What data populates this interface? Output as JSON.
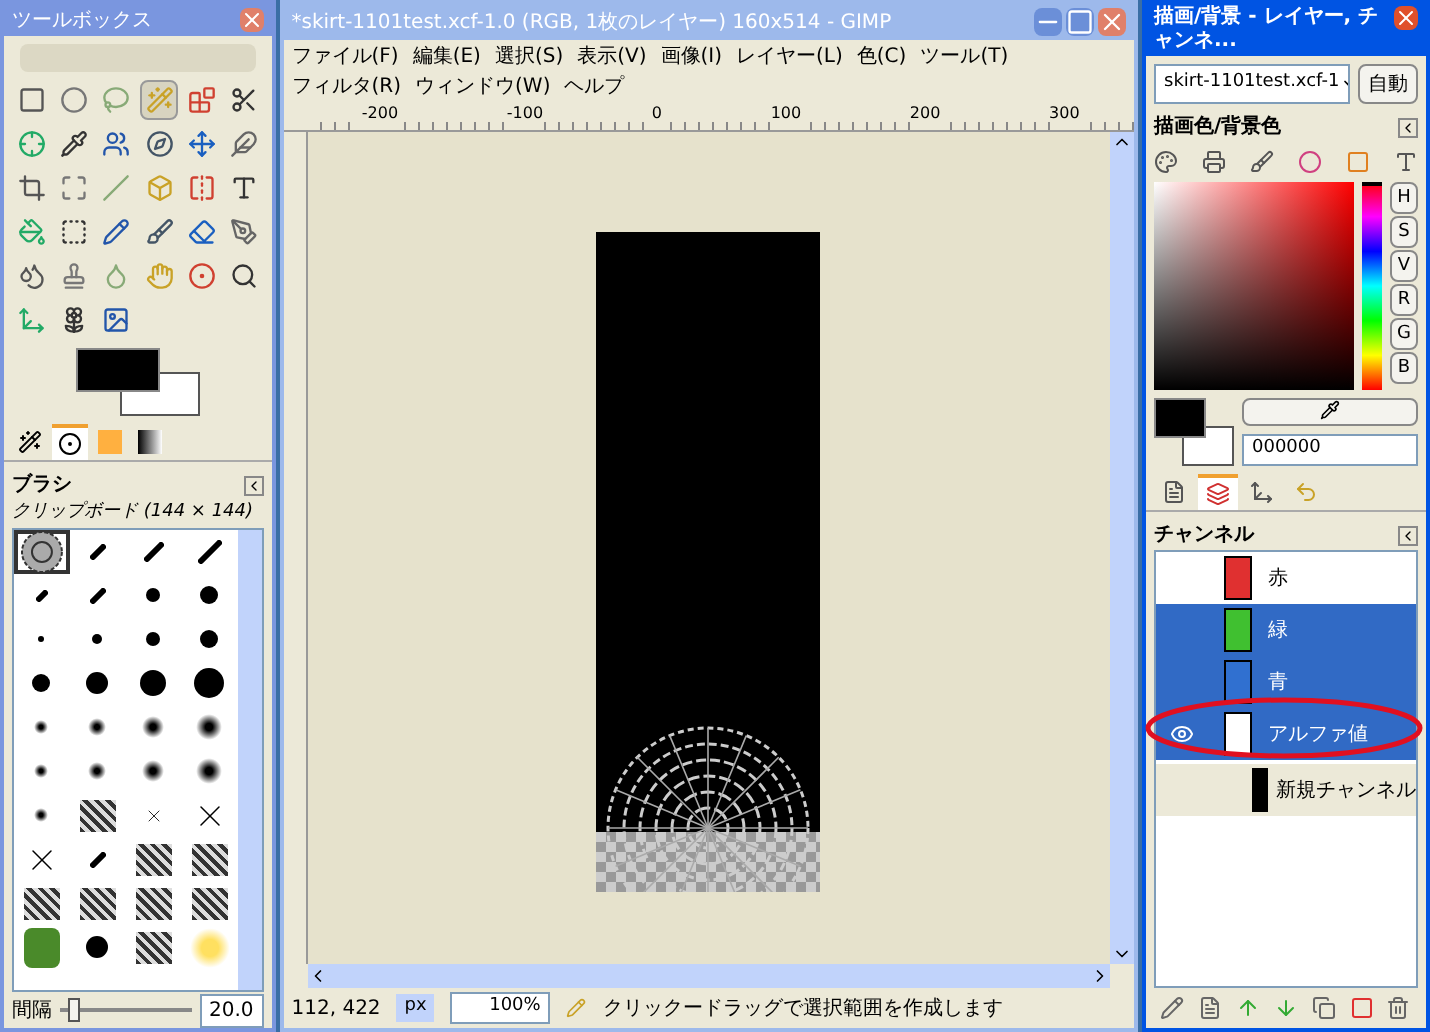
{
  "toolbox": {
    "title": "ツールボックス",
    "tools": [
      {
        "selected": false
      },
      {
        "selected": false
      },
      {
        "selected": false
      },
      {
        "selected": true
      },
      {
        "selected": false
      },
      {
        "selected": false
      },
      {
        "selected": false
      },
      {
        "selected": false
      },
      {
        "selected": false
      },
      {
        "selected": false
      },
      {
        "selected": false
      },
      {
        "selected": false
      },
      {
        "selected": false
      },
      {
        "selected": false
      },
      {
        "selected": false
      },
      {
        "selected": false
      },
      {
        "selected": false
      },
      {
        "selected": false
      },
      {
        "selected": false
      },
      {
        "selected": false
      },
      {
        "selected": false
      },
      {
        "selected": false
      },
      {
        "selected": false
      },
      {
        "selected": false
      },
      {
        "selected": false
      },
      {
        "selected": false
      },
      {
        "selected": false
      },
      {
        "selected": false
      },
      {
        "selected": false
      },
      {
        "selected": false
      },
      {
        "selected": false
      },
      {
        "selected": false
      },
      {
        "selected": false
      }
    ],
    "tabs": [
      {
        "selected": false
      },
      {
        "selected": true
      },
      {
        "selected": false
      },
      {
        "selected": false
      }
    ],
    "brushes": {
      "title": "ブラシ",
      "subtitle": "クリップボード (144 × 144)",
      "items": [
        {
          "kind": "clipboard",
          "selected": true
        },
        {
          "kind": "stroke",
          "selected": false
        },
        {
          "kind": "stroke",
          "selected": false
        },
        {
          "kind": "stroke",
          "selected": false
        },
        {
          "kind": "stroke",
          "selected": false
        },
        {
          "kind": "stroke",
          "selected": false
        },
        {
          "kind": "dot",
          "selected": false
        },
        {
          "kind": "dot",
          "selected": false
        },
        {
          "kind": "dot",
          "selected": false
        },
        {
          "kind": "dot",
          "selected": false
        },
        {
          "kind": "dot",
          "selected": false
        },
        {
          "kind": "dot",
          "selected": false
        },
        {
          "kind": "dot",
          "selected": false
        },
        {
          "kind": "dot",
          "selected": false
        },
        {
          "kind": "dot",
          "selected": false
        },
        {
          "kind": "dot",
          "selected": false
        },
        {
          "kind": "soft",
          "selected": false
        },
        {
          "kind": "soft",
          "selected": false
        },
        {
          "kind": "soft",
          "selected": false
        },
        {
          "kind": "soft",
          "selected": false
        },
        {
          "kind": "soft",
          "selected": false
        },
        {
          "kind": "soft",
          "selected": false
        },
        {
          "kind": "soft",
          "selected": false
        },
        {
          "kind": "soft",
          "selected": false
        },
        {
          "kind": "soft",
          "selected": false
        },
        {
          "kind": "texture",
          "selected": false
        },
        {
          "kind": "cross",
          "selected": false
        },
        {
          "kind": "cross",
          "selected": false
        },
        {
          "kind": "cross",
          "selected": false
        },
        {
          "kind": "stroke",
          "selected": false
        },
        {
          "kind": "texture",
          "selected": false
        },
        {
          "kind": "texture",
          "selected": false
        },
        {
          "kind": "texture",
          "selected": false
        },
        {
          "kind": "texture",
          "selected": false
        },
        {
          "kind": "texture",
          "selected": false
        },
        {
          "kind": "texture",
          "selected": false
        },
        {
          "kind": "photo",
          "selected": false
        },
        {
          "kind": "dot",
          "selected": false
        },
        {
          "kind": "texture",
          "selected": false
        },
        {
          "kind": "glow",
          "selected": false
        }
      ],
      "spacing": {
        "label": "間隔",
        "value": "20.0",
        "level": 0.1
      }
    }
  },
  "image_window": {
    "title": "*skirt-1101test.xcf-1.0 (RGB, 1枚のレイヤー) 160x514 - GIMP",
    "menu": [
      "ファイル(F)",
      "編集(E)",
      "選択(S)",
      "表示(V)",
      "画像(I)",
      "レイヤー(L)",
      "色(C)",
      "ツール(T)",
      "フィルタ(R)",
      "ウィンドウ(W)",
      "ヘルプ"
    ],
    "ruler_labels": [
      "-200",
      "-100",
      "0",
      "100",
      "200",
      "300"
    ],
    "status_bar": {
      "coords": "112, 422",
      "unit": "px",
      "zoom": "100%",
      "message": "クリックードラッグで選択範囲を作成します"
    }
  },
  "dock": {
    "title": "描画/背景 - レイヤー, チャンネ...",
    "image": "skirt-1101test.xcf-1",
    "auto_button": "自動",
    "color_panel": {
      "title": "描画色/背景色",
      "hue": {
        "level": 0
      },
      "sliders": [
        "H",
        "S",
        "V",
        "R",
        "G",
        "B"
      ],
      "hex": "000000"
    },
    "dock_tabs": [
      {
        "selected": false
      },
      {
        "selected": true
      },
      {
        "selected": false
      },
      {
        "selected": false
      }
    ],
    "channels_title": "チャンネル",
    "channels": [
      {
        "name": "赤",
        "selected": false,
        "visible": false,
        "color": "#e03030"
      },
      {
        "name": "緑",
        "selected": true,
        "visible": false,
        "color": "#40c030"
      },
      {
        "name": "青",
        "selected": true,
        "visible": false,
        "color": "#3070d0"
      },
      {
        "name": "アルファ値",
        "selected": true,
        "visible": true,
        "color": "#ffffff"
      }
    ],
    "new_channel": "新規チャンネル"
  }
}
